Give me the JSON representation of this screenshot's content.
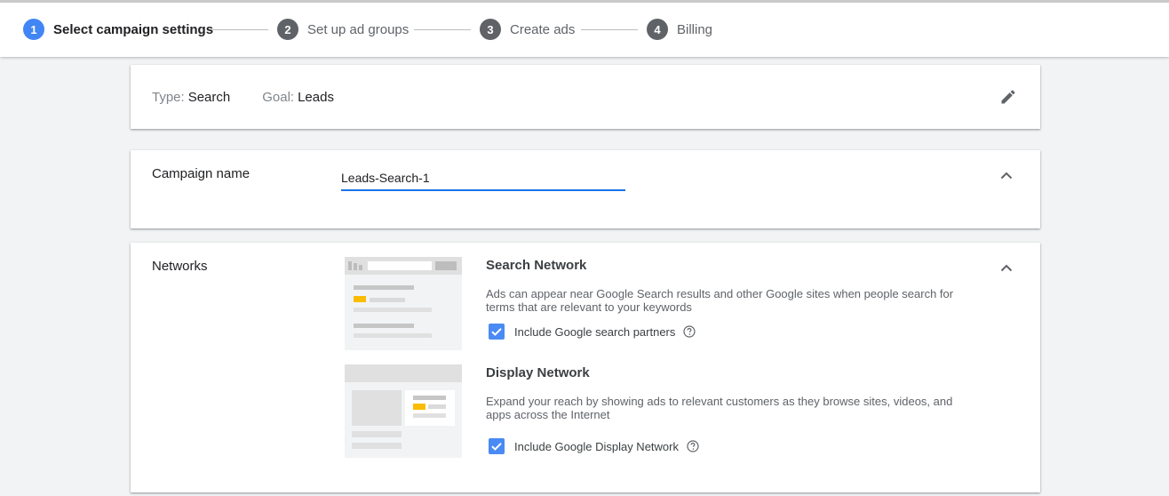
{
  "stepper": {
    "steps": [
      {
        "number": "1",
        "label": "Select campaign settings"
      },
      {
        "number": "2",
        "label": "Set up ad groups"
      },
      {
        "number": "3",
        "label": "Create ads"
      },
      {
        "number": "4",
        "label": "Billing"
      }
    ]
  },
  "summary": {
    "type_label": "Type:",
    "type_value": "Search",
    "goal_label": "Goal:",
    "goal_value": "Leads"
  },
  "campaign_name": {
    "label": "Campaign name",
    "value": "Leads-Search-1"
  },
  "networks": {
    "label": "Networks",
    "search": {
      "title": "Search Network",
      "description": "Ads can appear near Google Search results and other Google sites when people search for terms that are relevant to your keywords",
      "checkbox_label": "Include Google search partners",
      "checked": true
    },
    "display": {
      "title": "Display Network",
      "description": "Expand your reach by showing ads to relevant customers as they browse sites, videos, and apps across the Internet",
      "checkbox_label": "Include Google Display Network",
      "checked": true
    }
  },
  "icons": {
    "edit": "pencil-icon",
    "collapse": "chevron-up-icon",
    "help": "help-circle-icon",
    "check": "checkmark-icon"
  },
  "colors": {
    "accent": "#4285f4",
    "checkbox": "#4a8af4",
    "input_underline": "#1a73e8",
    "ad_highlight": "#fbbc04"
  }
}
